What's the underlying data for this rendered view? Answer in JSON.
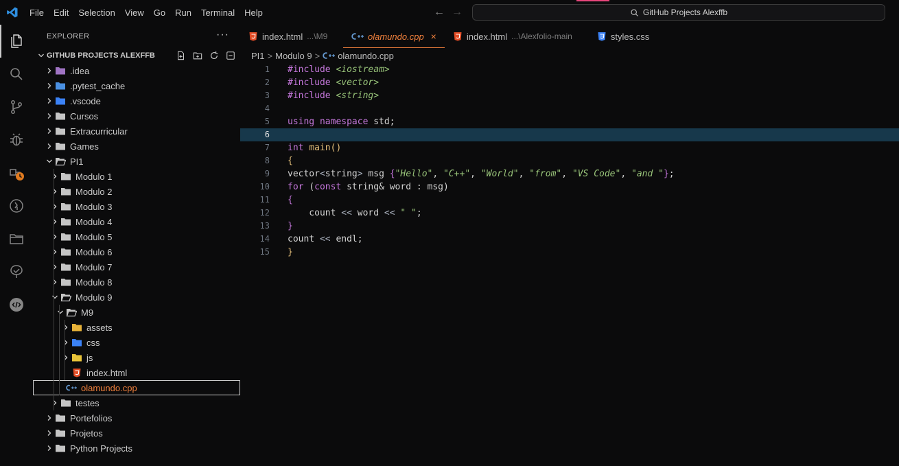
{
  "titlebar": {
    "menu": [
      "File",
      "Edit",
      "Selection",
      "View",
      "Go",
      "Run",
      "Terminal",
      "Help"
    ],
    "search": "GitHub Projects Alexffb"
  },
  "activity_icons": [
    "files-icon",
    "search-icon",
    "source-control-icon",
    "debug-icon",
    "extensions-update-icon",
    "remote-icon",
    "folder-icon",
    "testing-icon",
    "chat-icon"
  ],
  "sidebar": {
    "title": "EXPLORER",
    "more": "···",
    "root": "GITHUB PROJECTS ALEXFFB",
    "tree": [
      {
        "label": ".idea",
        "depth": 1,
        "type": "folder",
        "open": false,
        "color": "#a074c4"
      },
      {
        "label": ".pytest_cache",
        "depth": 1,
        "type": "folder",
        "open": false,
        "color": "#4a90e2"
      },
      {
        "label": ".vscode",
        "depth": 1,
        "type": "folder",
        "open": false,
        "color": "#3b82f6"
      },
      {
        "label": "Cursos",
        "depth": 1,
        "type": "folder",
        "open": false,
        "color": "#c5c5c5"
      },
      {
        "label": "Extracurricular",
        "depth": 1,
        "type": "folder",
        "open": false,
        "color": "#c5c5c5"
      },
      {
        "label": "Games",
        "depth": 1,
        "type": "folder",
        "open": false,
        "color": "#c5c5c5"
      },
      {
        "label": "PI1",
        "depth": 1,
        "type": "folder",
        "open": true,
        "color": "#c5c5c5"
      },
      {
        "label": "Modulo 1",
        "depth": 2,
        "type": "folder",
        "open": false,
        "color": "#c5c5c5"
      },
      {
        "label": "Modulo 2",
        "depth": 2,
        "type": "folder",
        "open": false,
        "color": "#c5c5c5"
      },
      {
        "label": "Modulo 3",
        "depth": 2,
        "type": "folder",
        "open": false,
        "color": "#c5c5c5"
      },
      {
        "label": "Modulo 4",
        "depth": 2,
        "type": "folder",
        "open": false,
        "color": "#c5c5c5"
      },
      {
        "label": "Modulo 5",
        "depth": 2,
        "type": "folder",
        "open": false,
        "color": "#c5c5c5"
      },
      {
        "label": "Modulo 6",
        "depth": 2,
        "type": "folder",
        "open": false,
        "color": "#c5c5c5"
      },
      {
        "label": "Modulo 7",
        "depth": 2,
        "type": "folder",
        "open": false,
        "color": "#c5c5c5"
      },
      {
        "label": "Modulo 8",
        "depth": 2,
        "type": "folder",
        "open": false,
        "color": "#c5c5c5"
      },
      {
        "label": "Modulo 9",
        "depth": 2,
        "type": "folder",
        "open": true,
        "color": "#c5c5c5"
      },
      {
        "label": "M9",
        "depth": 3,
        "type": "folder",
        "open": true,
        "color": "#c5c5c5"
      },
      {
        "label": "assets",
        "depth": 4,
        "type": "folder",
        "open": false,
        "color": "#e8b339"
      },
      {
        "label": "css",
        "depth": 4,
        "type": "folder",
        "open": false,
        "color": "#3b82f6"
      },
      {
        "label": "js",
        "depth": 4,
        "type": "folder",
        "open": false,
        "color": "#e8c339"
      },
      {
        "label": "index.html",
        "depth": 4,
        "type": "html",
        "color": "#e44d26"
      },
      {
        "label": "olamundo.cpp",
        "depth": 3,
        "type": "cpp",
        "color": "#659ad2",
        "selected": true
      },
      {
        "label": "testes",
        "depth": 2,
        "type": "folder",
        "open": false,
        "color": "#c5c5c5"
      },
      {
        "label": "Portefolios",
        "depth": 1,
        "type": "folder",
        "open": false,
        "color": "#c5c5c5"
      },
      {
        "label": "Projetos",
        "depth": 1,
        "type": "folder",
        "open": false,
        "color": "#c5c5c5"
      },
      {
        "label": "Python Projects",
        "depth": 1,
        "type": "folder",
        "open": false,
        "color": "#c5c5c5"
      }
    ]
  },
  "tabs": [
    {
      "name": "index.html",
      "desc": "...\\M9",
      "type": "html",
      "active": false
    },
    {
      "name": "olamundo.cpp",
      "desc": "",
      "type": "cpp",
      "active": true,
      "close": "×"
    },
    {
      "name": "index.html",
      "desc": "...\\Alexfolio-main",
      "type": "html",
      "active": false
    },
    {
      "name": "styles.css",
      "desc": "",
      "type": "css",
      "active": false
    }
  ],
  "breadcrumb": {
    "parts": [
      "PI1",
      "Modulo 9"
    ],
    "file": "olamundo.cpp",
    "sep": ">"
  },
  "editor": {
    "current_line": 6,
    "lines": [
      [
        [
          "pre",
          "#include "
        ],
        [
          "inc",
          "<iostream>"
        ]
      ],
      [
        [
          "pre",
          "#include "
        ],
        [
          "inc",
          "<vector>"
        ]
      ],
      [
        [
          "pre",
          "#include "
        ],
        [
          "inc",
          "<string>"
        ]
      ],
      [],
      [
        [
          "kw",
          "using namespace "
        ],
        [
          "plain",
          "std;"
        ]
      ],
      [],
      [
        [
          "type",
          "int "
        ],
        [
          "fn",
          "main"
        ],
        [
          "brace",
          "()"
        ]
      ],
      [
        [
          "brace",
          "{"
        ]
      ],
      [
        [
          "plain",
          "vector"
        ],
        [
          "op",
          "<"
        ],
        [
          "plain",
          "string"
        ],
        [
          "op",
          ">"
        ],
        [
          "plain",
          " msg "
        ],
        [
          "brace2",
          "{"
        ],
        [
          "str",
          "\"Hello\""
        ],
        [
          "plain",
          ", "
        ],
        [
          "str",
          "\"C++\""
        ],
        [
          "plain",
          ", "
        ],
        [
          "str",
          "\"World\""
        ],
        [
          "plain",
          ", "
        ],
        [
          "str",
          "\"from\""
        ],
        [
          "plain",
          ", "
        ],
        [
          "str",
          "\"VS Code\""
        ],
        [
          "plain",
          ", "
        ],
        [
          "str",
          "\"and \""
        ],
        [
          "brace2",
          "}"
        ],
        [
          "plain",
          ";"
        ]
      ],
      [
        [
          "kw",
          "for "
        ],
        [
          "plain",
          "("
        ],
        [
          "kw",
          "const "
        ],
        [
          "plain",
          "string& word : msg)"
        ]
      ],
      [
        [
          "brace2",
          "{"
        ]
      ],
      [
        [
          "plain",
          "    count "
        ],
        [
          "op",
          "<<"
        ],
        [
          "plain",
          " word "
        ],
        [
          "op",
          "<<"
        ],
        [
          "plain",
          " "
        ],
        [
          "str",
          "\" \""
        ],
        [
          "plain",
          ";"
        ]
      ],
      [
        [
          "brace2",
          "}"
        ]
      ],
      [
        [
          "plain",
          "count "
        ],
        [
          "op",
          "<<"
        ],
        [
          "plain",
          " endl;"
        ]
      ],
      [
        [
          "brace",
          "}"
        ]
      ]
    ]
  }
}
